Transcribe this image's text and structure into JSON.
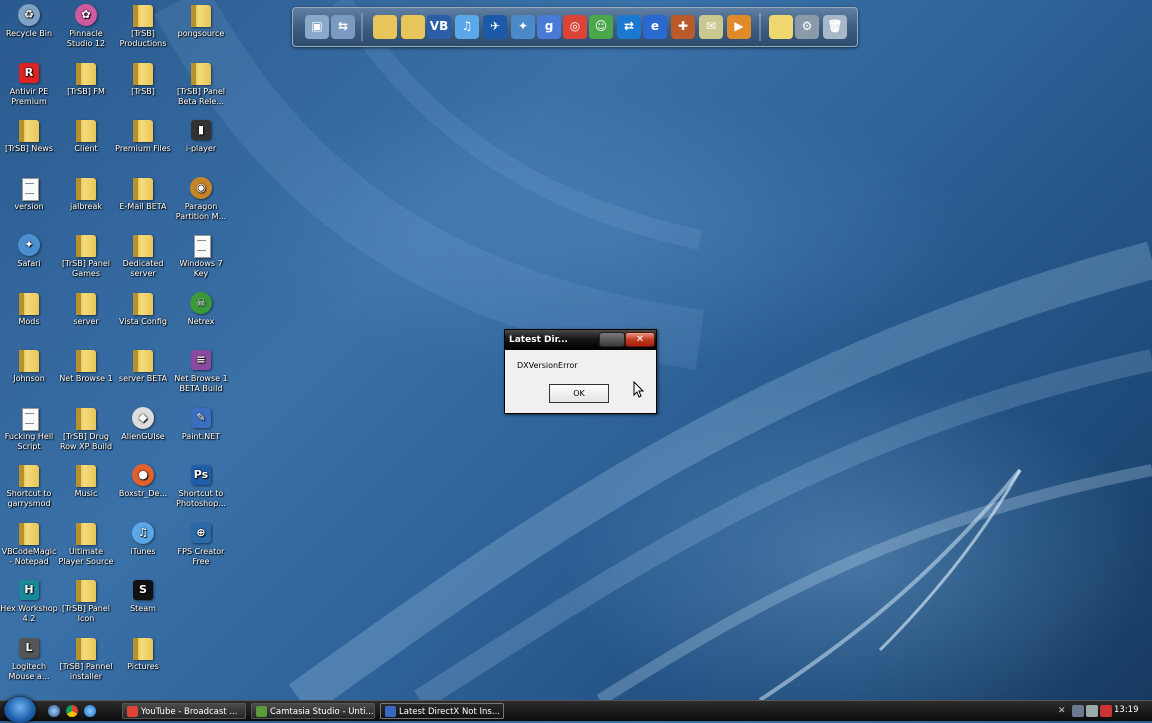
{
  "desktop": {
    "icons": [
      {
        "label": "Recycle Bin",
        "icon": "recycle-bin-icon"
      },
      {
        "label": "Pinnacle Studio 12",
        "icon": "pinnacle-studio-icon"
      },
      {
        "label": "[TrSB] Productions",
        "icon": "folder-icon"
      },
      {
        "label": "pongsource",
        "icon": "folder-icon"
      },
      {
        "label": "Antivir PE Premium",
        "icon": "antivir-icon"
      },
      {
        "label": "[TrSB] FM",
        "icon": "folder-icon"
      },
      {
        "label": "[TrSB]",
        "icon": "folder-icon"
      },
      {
        "label": "[TrSB] Panel Beta Rele...",
        "icon": "folder-icon"
      },
      {
        "label": "[TrSB] News",
        "icon": "folder-icon"
      },
      {
        "label": "Client",
        "icon": "folder-icon"
      },
      {
        "label": "Premium Files",
        "icon": "folder-icon"
      },
      {
        "label": "i-player",
        "icon": "iplayer-icon"
      },
      {
        "label": "version",
        "icon": "document-icon"
      },
      {
        "label": "jalbreak",
        "icon": "folder-icon"
      },
      {
        "label": "E-Mail BETA",
        "icon": "folder-icon"
      },
      {
        "label": "Paragon Partition M...",
        "icon": "paragon-icon"
      },
      {
        "label": "Safari",
        "icon": "safari-icon"
      },
      {
        "label": "[TrSB] Panel Games",
        "icon": "folder-icon"
      },
      {
        "label": "Dedicated server",
        "icon": "folder-icon"
      },
      {
        "label": "Windows 7 Key",
        "icon": "document-icon"
      },
      {
        "label": "Mods",
        "icon": "folder-icon"
      },
      {
        "label": "server",
        "icon": "folder-icon"
      },
      {
        "label": "Vista Config",
        "icon": "folder-icon"
      },
      {
        "label": "Netrex",
        "icon": "netrex-icon"
      },
      {
        "label": "Johnson",
        "icon": "folder-icon"
      },
      {
        "label": "Net Browse 1",
        "icon": "folder-icon"
      },
      {
        "label": "server BETA",
        "icon": "folder-icon"
      },
      {
        "label": "Net Browse 1 BETA Build",
        "icon": "winrar-icon"
      },
      {
        "label": "Fucking Hell Script",
        "icon": "document-icon"
      },
      {
        "label": "[TrSB] Drug Row XP Build",
        "icon": "folder-icon"
      },
      {
        "label": "AlienGUIse",
        "icon": "alien-icon"
      },
      {
        "label": "Paint.NET",
        "icon": "paintnet-icon"
      },
      {
        "label": "Shortcut to garrysmod",
        "icon": "folder-icon"
      },
      {
        "label": "Music",
        "icon": "folder-icon"
      },
      {
        "label": "Boxstr_De...",
        "icon": "boxstr-icon"
      },
      {
        "label": "Shortcut to Photoshop...",
        "icon": "photoshop-icon"
      },
      {
        "label": "VBCodeMagic - Notepad",
        "icon": "folder-icon"
      },
      {
        "label": "Ultimate Player Source",
        "icon": "folder-icon"
      },
      {
        "label": "iTunes",
        "icon": "itunes-icon"
      },
      {
        "label": "FPS Creator Free",
        "icon": "fps-creator-icon"
      },
      {
        "label": "Hex Workshop 4.2",
        "icon": "hex-workshop-icon"
      },
      {
        "label": "[TrSB] Panel Icon",
        "icon": "folder-icon"
      },
      {
        "label": "Steam",
        "icon": "steam-icon"
      },
      {
        "label": "",
        "icon": "blank"
      },
      {
        "label": "Logitech Mouse a...",
        "icon": "logitech-icon"
      },
      {
        "label": "[TrSB] Pannel installer",
        "icon": "folder-icon"
      },
      {
        "label": "Pictures",
        "icon": "folder-icon"
      }
    ]
  },
  "dock": {
    "items": [
      "computer-icon",
      "network-icon",
      "folder-icon",
      "folder-icon",
      "vb-icon",
      "itunes-icon",
      "swallow-icon",
      "safari-icon",
      "g-icon",
      "chrome-icon",
      "messenger-icon",
      "teamviewer-icon",
      "ie-icon",
      "tf2-icon",
      "mail-icon",
      "media-player-icon",
      "notes-folder-icon",
      "settings-gear-icon",
      "trash-icon"
    ]
  },
  "dialog": {
    "title": "Latest Dir...",
    "close_glyph": "✕",
    "message": "DXVersionError",
    "ok_label": "OK"
  },
  "taskbar": {
    "quick_launch": [
      "show-desktop-icon",
      "chrome-icon",
      "ie-icon"
    ],
    "buttons": [
      {
        "label": "YouTube - Broadcast ...",
        "icon": "chrome-icon",
        "active": false
      },
      {
        "label": "Camtasia Studio - Unti...",
        "icon": "camtasia-icon",
        "active": false
      },
      {
        "label": "Latest DirectX Not Ins...",
        "icon": "app-icon",
        "active": true
      }
    ],
    "tray": [
      "arrow-icon",
      "network-icon",
      "volume-icon",
      "app-icon"
    ],
    "clock": "13:19"
  },
  "colors": {
    "taskbar": "#111111",
    "dialog_title": "#000000",
    "close_button": "#c23b22",
    "desktop": "#2e6399"
  }
}
